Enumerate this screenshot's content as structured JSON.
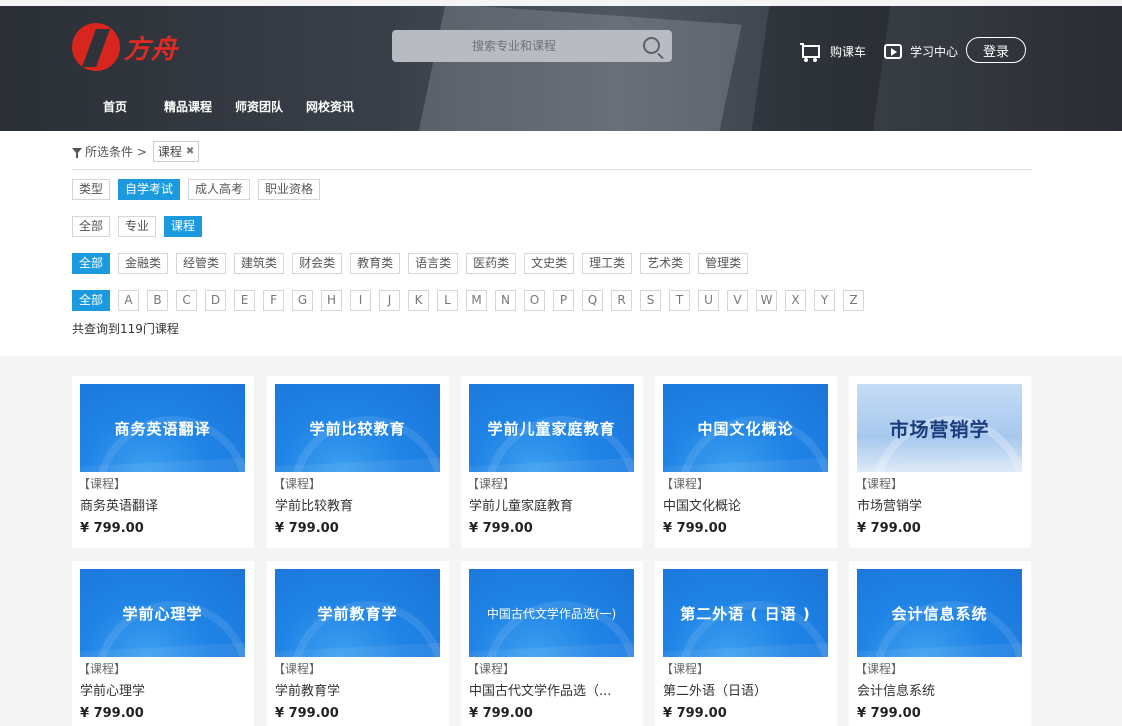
{
  "header": {
    "logo_text": "方舟",
    "search_placeholder": "搜索专业和课程",
    "cart_label": "购课车",
    "study_center_label": "学习中心",
    "login_label": "登录",
    "nav": [
      "首页",
      "精品课程",
      "师资团队",
      "网校资讯"
    ]
  },
  "filter": {
    "crumb_label": "所选条件 >",
    "selected_tag": "课程",
    "remove_icon": "✖",
    "exam_types": [
      {
        "label": "类型",
        "active": false
      },
      {
        "label": "自学考试",
        "active": true
      },
      {
        "label": "成人高考",
        "active": false
      },
      {
        "label": "职业资格",
        "active": false
      }
    ],
    "scope": [
      {
        "label": "全部",
        "active": false
      },
      {
        "label": "专业",
        "active": false
      },
      {
        "label": "课程",
        "active": true
      }
    ],
    "categories": [
      {
        "label": "全部",
        "active": true
      },
      {
        "label": "金融类",
        "active": false
      },
      {
        "label": "经管类",
        "active": false
      },
      {
        "label": "建筑类",
        "active": false
      },
      {
        "label": "财会类",
        "active": false
      },
      {
        "label": "教育类",
        "active": false
      },
      {
        "label": "语言类",
        "active": false
      },
      {
        "label": "医药类",
        "active": false
      },
      {
        "label": "文史类",
        "active": false
      },
      {
        "label": "理工类",
        "active": false
      },
      {
        "label": "艺术类",
        "active": false
      },
      {
        "label": "管理类",
        "active": false
      }
    ],
    "letters_all": "全部",
    "letters": [
      "A",
      "B",
      "C",
      "D",
      "E",
      "F",
      "G",
      "H",
      "I",
      "J",
      "K",
      "L",
      "M",
      "N",
      "O",
      "P",
      "Q",
      "R",
      "S",
      "T",
      "U",
      "V",
      "W",
      "X",
      "Y",
      "Z"
    ],
    "result_count": "共查询到119门课程"
  },
  "courses": [
    {
      "thumb_title": "商务英语翻译",
      "type": "【课程】",
      "name": "商务英语翻译",
      "price": "¥ 799.00",
      "style": "blue"
    },
    {
      "thumb_title": "学前比较教育",
      "type": "【课程】",
      "name": "学前比较教育",
      "price": "¥ 799.00",
      "style": "blue"
    },
    {
      "thumb_title": "学前儿童家庭教育",
      "type": "【课程】",
      "name": "学前儿童家庭教育",
      "price": "¥ 799.00",
      "style": "blue"
    },
    {
      "thumb_title": "中国文化概论",
      "type": "【课程】",
      "name": "中国文化概论",
      "price": "¥ 799.00",
      "style": "blue"
    },
    {
      "thumb_title": "市场营销学",
      "type": "【课程】",
      "name": "市场营销学",
      "price": "¥ 799.00",
      "style": "light"
    },
    {
      "thumb_title": "学前心理学",
      "type": "【课程】",
      "name": "学前心理学",
      "price": "¥ 799.00",
      "style": "blue"
    },
    {
      "thumb_title": "学前教育学",
      "type": "【课程】",
      "name": "学前教育学",
      "price": "¥ 799.00",
      "style": "blue"
    },
    {
      "thumb_title": "中国古代文学作品选(一)",
      "type": "【课程】",
      "name": "中国古代文学作品选（...",
      "price": "¥ 799.00",
      "style": "blue-small"
    },
    {
      "thumb_title": "第二外语 ( 日语 )",
      "type": "【课程】",
      "name": "第二外语（日语）",
      "price": "¥ 799.00",
      "style": "blue"
    },
    {
      "thumb_title": "会计信息系统",
      "type": "【课程】",
      "name": "会计信息系统",
      "price": "¥ 799.00",
      "style": "blue"
    }
  ],
  "colors": {
    "accent": "#1b9ae0",
    "brand_red": "#d8261f"
  }
}
